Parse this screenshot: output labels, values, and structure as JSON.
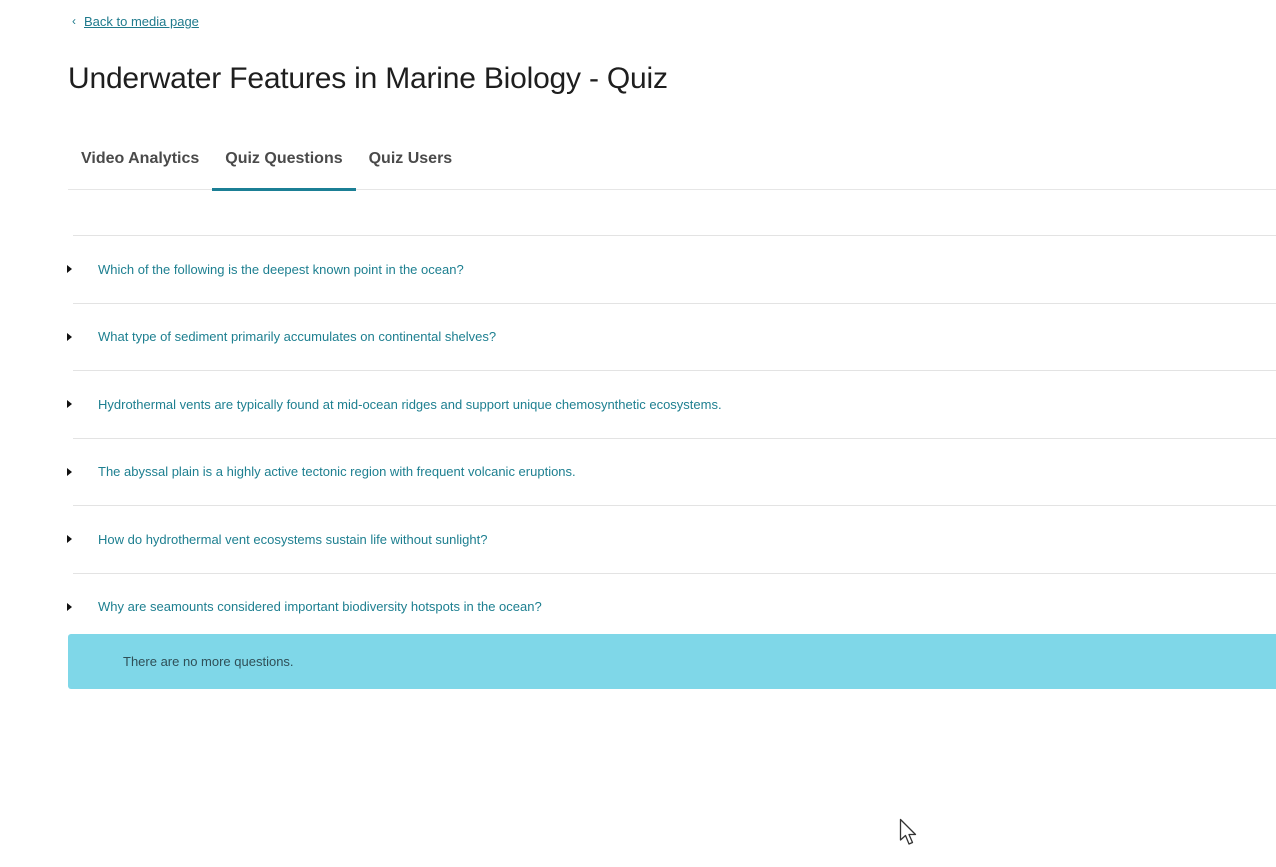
{
  "nav": {
    "back_label": "Back to media page"
  },
  "header": {
    "title": "Underwater Features in Marine Biology - Quiz"
  },
  "tabs": [
    {
      "label": "Video Analytics",
      "active": false
    },
    {
      "label": "Quiz Questions",
      "active": true
    },
    {
      "label": "Quiz Users",
      "active": false
    }
  ],
  "questions": [
    {
      "text": "Which of the following is the deepest known point in the ocean?"
    },
    {
      "text": "What type of sediment primarily accumulates on continental shelves?"
    },
    {
      "text": "Hydrothermal vents are typically found at mid-ocean ridges and support unique chemosynthetic ecosystems."
    },
    {
      "text": "The abyssal plain is a highly active tectonic region with frequent volcanic eruptions."
    },
    {
      "text": "How do hydrothermal vent ecosystems sustain life without sunlight?"
    },
    {
      "text": "Why are seamounts considered important biodiversity hotspots in the ocean?"
    }
  ],
  "notice": {
    "text": "There are no more questions."
  },
  "colors": {
    "accent": "#1b7f95",
    "link": "#1d7f90",
    "notice_bg": "#7fd7e8"
  },
  "icons": {
    "back": "chevron-left-icon",
    "expand": "caret-right-icon",
    "pointer": "mouse-pointer-icon"
  }
}
